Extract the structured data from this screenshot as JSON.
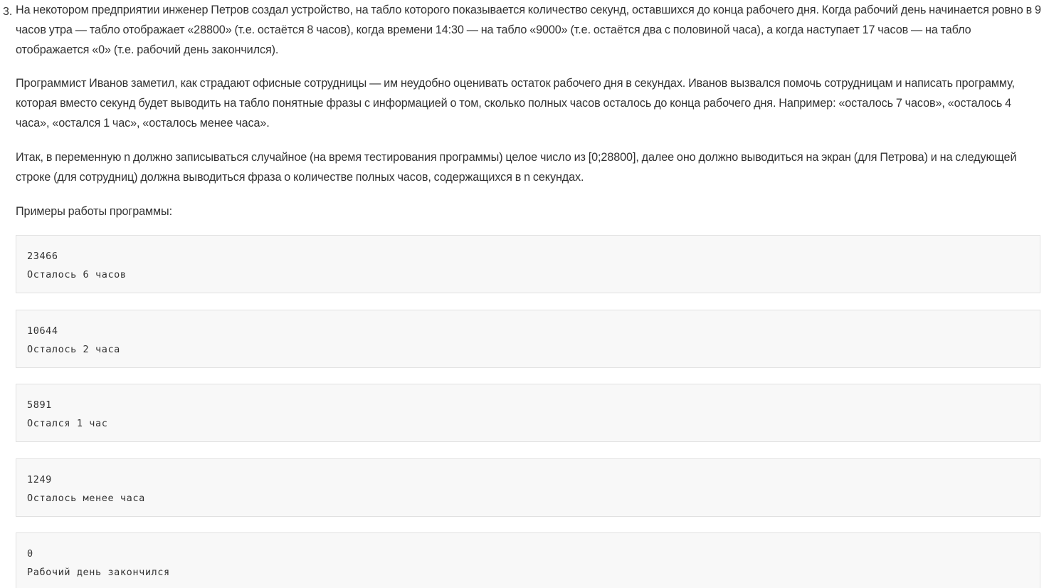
{
  "task": {
    "number": "3.",
    "paragraphs": [
      "На некотором предприятии инженер Петров создал устройство, на табло которого показывается количество секунд, оставшихся до конца рабочего дня. Когда рабочий день начинается ровно в 9 часов утра — табло отображает «28800» (т.е. остаётся 8 часов), когда времени 14:30 — на табло «9000» (т.е. остаётся два с половиной часа), а когда наступает 17 часов — на табло отображается «0» (т.е. рабочий день закончился).",
      "Программист Иванов заметил, как страдают офисные сотрудницы — им неудобно оценивать остаток рабочего дня в секундах. Иванов вызвался помочь сотрудницам и написать программу, которая вместо секунд будет выводить на табло понятные фразы с информацией о том, сколько полных часов осталось до конца рабочего дня. Например: «осталось 7 часов», «осталось 4 часа», «остался 1 час», «осталось менее часа».",
      "Итак, в переменную n должно записываться случайное (на время тестирования программы) целое число из [0;28800], далее оно должно выводиться на экран (для Петрова) и на следующей строке (для сотрудниц) должна выводиться фраза о количестве полных часов, содержащихся в n секундах.",
      "Примеры работы программы:"
    ],
    "examples": [
      {
        "input": "23466",
        "output": "Осталось 6 часов"
      },
      {
        "input": "10644",
        "output": "Осталось 2 часа"
      },
      {
        "input": "5891",
        "output": "Остался 1 час"
      },
      {
        "input": "1249",
        "output": "Осталось менее часа"
      },
      {
        "input": "0",
        "output": "Рабочий день закончился"
      }
    ]
  }
}
